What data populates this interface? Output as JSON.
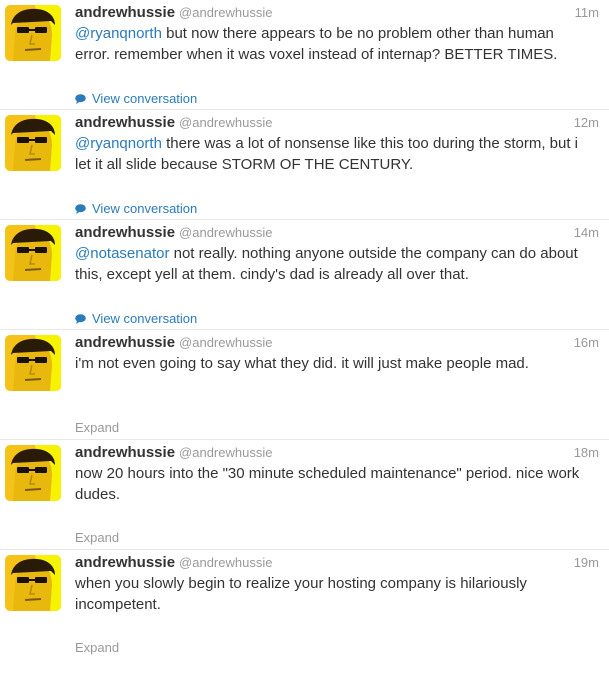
{
  "colors": {
    "link": "#2b7bb9",
    "muted": "#999999",
    "text": "#333333",
    "divider": "#e8e8e8",
    "avatar_yellow": "#f5c218",
    "avatar_bright_yellow": "#f6f200"
  },
  "tweets": [
    {
      "fullname": "andrewhussie",
      "username": "@andrewhussie",
      "time": "11m",
      "mention": "@ryanqnorth",
      "text": " but now there appears to be no problem other than human error. remember when it was voxel instead of internap? BETTER TIMES.",
      "action_label": "View conversation",
      "action_icon": "speech-bubble-icon"
    },
    {
      "fullname": "andrewhussie",
      "username": "@andrewhussie",
      "time": "12m",
      "mention": "@ryanqnorth",
      "text": " there was a lot of nonsense like this too during the storm, but i let it all slide because STORM OF THE CENTURY.",
      "action_label": "View conversation",
      "action_icon": "speech-bubble-icon"
    },
    {
      "fullname": "andrewhussie",
      "username": "@andrewhussie",
      "time": "14m",
      "mention": "@notasenator",
      "text": " not really. nothing anyone outside the company can do about this, except yell at them. cindy's dad is already all over that.",
      "action_label": "View conversation",
      "action_icon": "speech-bubble-icon"
    },
    {
      "fullname": "andrewhussie",
      "username": "@andrewhussie",
      "time": "16m",
      "text": "i'm not even going to say what they did. it will just make people mad.",
      "action_label": "Expand"
    },
    {
      "fullname": "andrewhussie",
      "username": "@andrewhussie",
      "time": "18m",
      "text": "now 20 hours into the \"30 minute scheduled maintenance\" period. nice work dudes.",
      "action_label": "Expand"
    },
    {
      "fullname": "andrewhussie",
      "username": "@andrewhussie",
      "time": "19m",
      "text": "when you slowly begin to realize your hosting company is hilariously incompetent.",
      "action_label": "Expand"
    }
  ]
}
